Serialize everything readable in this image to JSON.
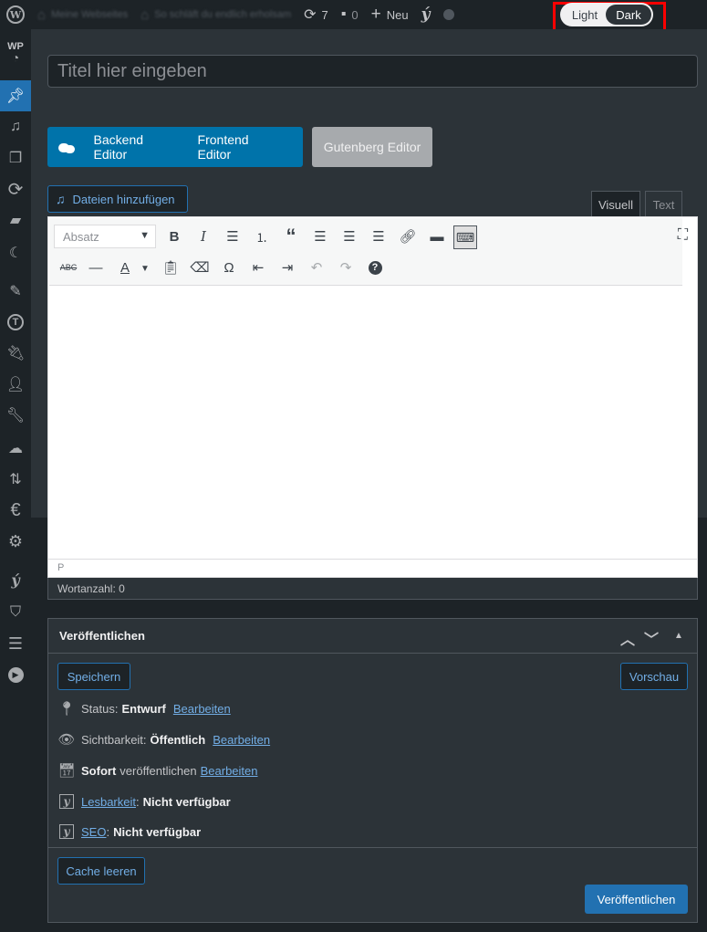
{
  "adminbar": {
    "site_name": "Meine Webseites",
    "page_name": "So schläft du endlich erholsam",
    "updates_count": "7",
    "comments_count": "0",
    "new_label": "Neu",
    "theme_light": "Light",
    "theme_dark": "Dark"
  },
  "sidebar": {
    "wp_tag": "WP"
  },
  "title": {
    "placeholder": "Titel hier eingeben"
  },
  "editor_switch": {
    "backend_label": "Backend Editor",
    "frontend_label": "Frontend Editor",
    "gutenberg_label": "Gutenberg Editor"
  },
  "media": {
    "add_label": "Dateien hinzufügen"
  },
  "tabs": {
    "visual": "Visuell",
    "text": "Text"
  },
  "toolbar": {
    "format_value": "Absatz"
  },
  "status": {
    "path": "P",
    "word_count": "Wortanzahl: 0"
  },
  "publish": {
    "title": "Veröffentlichen",
    "save_label": "Speichern",
    "preview_label": "Vorschau",
    "status_label": "Status:",
    "status_value": "Entwurf",
    "visibility_label": "Sichtbarkeit:",
    "visibility_value": "Öffentlich",
    "schedule_value": "Sofort",
    "schedule_label": "veröffentlichen",
    "edit_link": "Bearbeiten",
    "readability_link": "Lesbarkeit",
    "readability_value": "Nicht verfügbar",
    "seo_link": "SEO",
    "seo_value": "Nicht verfügbar",
    "cache_label": "Cache leeren",
    "publish_label": "Veröffentlichen"
  }
}
